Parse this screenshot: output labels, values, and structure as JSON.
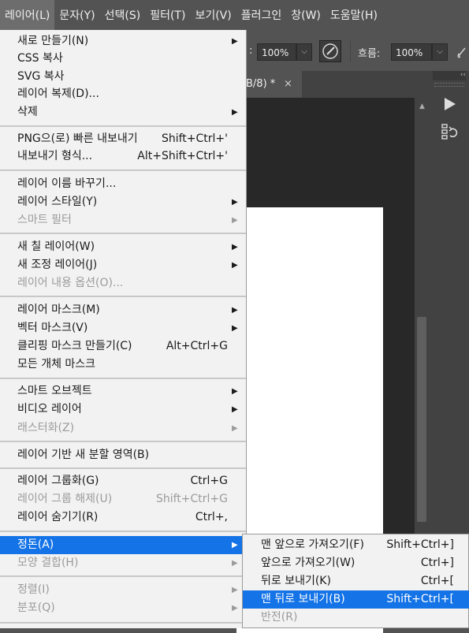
{
  "menubar": {
    "items": [
      "레이어(L)",
      "문자(Y)",
      "선택(S)",
      "필터(T)",
      "보기(V)",
      "플러그인",
      "창(W)",
      "도움말(H)"
    ],
    "active_index": 0
  },
  "options_bar": {
    "opacity_value": "100%",
    "flow_label": "흐름:",
    "flow_value": "100%",
    "brush_icon": "brush-pressure-icon"
  },
  "document": {
    "tab_title": "B/8) *",
    "close_glyph": "×"
  },
  "right_panel": {
    "collapse_glyph": "‹‹",
    "play_icon": "play-icon",
    "history_icon": "history-icon"
  },
  "menu": {
    "items": [
      {
        "label": "새로 만들기(N)",
        "shortcut": "",
        "submenu": true,
        "enabled": true
      },
      {
        "label": "CSS 복사",
        "shortcut": "",
        "submenu": false,
        "enabled": true
      },
      {
        "label": "SVG 복사",
        "shortcut": "",
        "submenu": false,
        "enabled": true
      },
      {
        "label": "레이어 복제(D)...",
        "shortcut": "",
        "submenu": false,
        "enabled": true
      },
      {
        "label": "삭제",
        "shortcut": "",
        "submenu": true,
        "enabled": true
      },
      {
        "label": "PNG으(로) 빠른 내보내기",
        "shortcut": "Shift+Ctrl+'",
        "submenu": false,
        "enabled": true
      },
      {
        "label": "내보내기 형식...",
        "shortcut": "Alt+Shift+Ctrl+'",
        "submenu": false,
        "enabled": true
      },
      {
        "label": "레이어 이름 바꾸기...",
        "shortcut": "",
        "submenu": false,
        "enabled": true
      },
      {
        "label": "레이어 스타일(Y)",
        "shortcut": "",
        "submenu": true,
        "enabled": true
      },
      {
        "label": "스마트 필터",
        "shortcut": "",
        "submenu": true,
        "enabled": false
      },
      {
        "label": "새 칠 레이어(W)",
        "shortcut": "",
        "submenu": true,
        "enabled": true
      },
      {
        "label": "새 조정 레이어(J)",
        "shortcut": "",
        "submenu": true,
        "enabled": true
      },
      {
        "label": "레이어 내용 옵션(O)...",
        "shortcut": "",
        "submenu": false,
        "enabled": false
      },
      {
        "label": "레이어 마스크(M)",
        "shortcut": "",
        "submenu": true,
        "enabled": true
      },
      {
        "label": "벡터 마스크(V)",
        "shortcut": "",
        "submenu": true,
        "enabled": true
      },
      {
        "label": "클리핑 마스크 만들기(C)",
        "shortcut": "Alt+Ctrl+G",
        "submenu": false,
        "enabled": true
      },
      {
        "label": "모든 개체 마스크",
        "shortcut": "",
        "submenu": false,
        "enabled": true
      },
      {
        "label": "스마트 오브젝트",
        "shortcut": "",
        "submenu": true,
        "enabled": true
      },
      {
        "label": "비디오 레이어",
        "shortcut": "",
        "submenu": true,
        "enabled": true
      },
      {
        "label": "래스터화(Z)",
        "shortcut": "",
        "submenu": true,
        "enabled": false
      },
      {
        "label": "레이어 기반 새 분할 영역(B)",
        "shortcut": "",
        "submenu": false,
        "enabled": true
      },
      {
        "label": "레이어 그룹화(G)",
        "shortcut": "Ctrl+G",
        "submenu": false,
        "enabled": true
      },
      {
        "label": "레이어 그룹 해제(U)",
        "shortcut": "Shift+Ctrl+G",
        "submenu": false,
        "enabled": false
      },
      {
        "label": "레이어 숨기기(R)",
        "shortcut": "Ctrl+,",
        "submenu": false,
        "enabled": true
      },
      {
        "label": "정돈(A)",
        "shortcut": "",
        "submenu": true,
        "enabled": true,
        "selected": true
      },
      {
        "label": "모양 결합(H)",
        "shortcut": "",
        "submenu": true,
        "enabled": false
      },
      {
        "label": "정렬(I)",
        "shortcut": "",
        "submenu": true,
        "enabled": false
      },
      {
        "label": "분포(Q)",
        "shortcut": "",
        "submenu": true,
        "enabled": false
      }
    ],
    "arrow_glyph": "▶"
  },
  "submenu": {
    "items": [
      {
        "label": "맨 앞으로 가져오기(F)",
        "shortcut": "Shift+Ctrl+]",
        "enabled": true
      },
      {
        "label": "앞으로 가져오기(W)",
        "shortcut": "Ctrl+]",
        "enabled": true
      },
      {
        "label": "뒤로 보내기(K)",
        "shortcut": "Ctrl+[",
        "enabled": true
      },
      {
        "label": "맨 뒤로 보내기(B)",
        "shortcut": "Shift+Ctrl+[",
        "enabled": true,
        "selected": true
      },
      {
        "label": "반전(R)",
        "shortcut": "",
        "enabled": false
      }
    ]
  }
}
